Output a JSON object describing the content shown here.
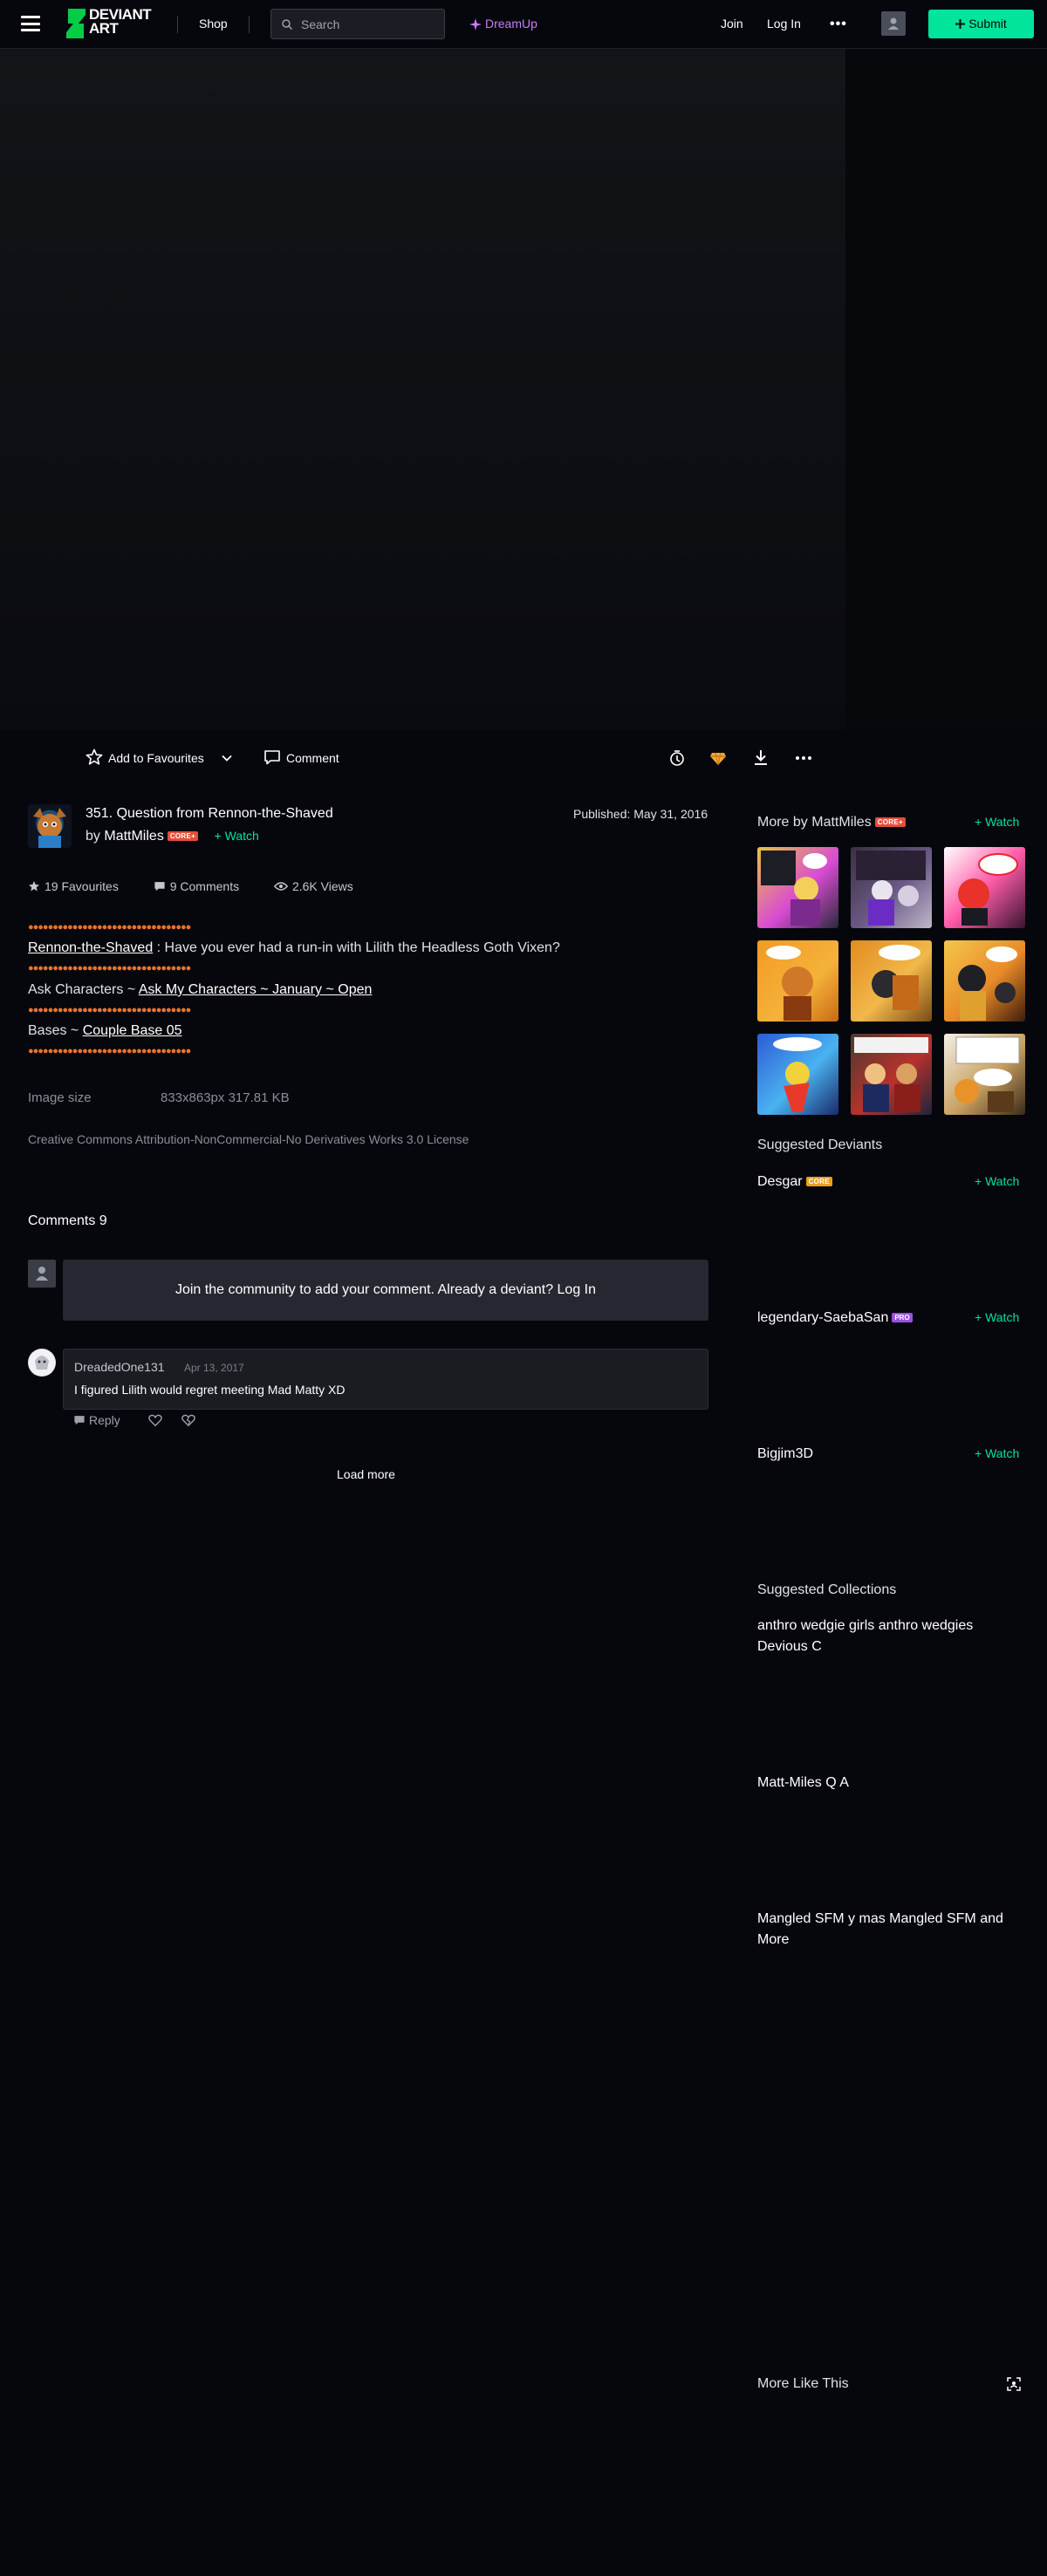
{
  "header": {
    "shop_label": "Shop",
    "search_placeholder": "Search",
    "dreamup_label": "DreamUp",
    "join_label": "Join",
    "login_label": "Log In",
    "more_label": "•••",
    "submit_label": "Submit",
    "logo_text": "DEVIANT ART"
  },
  "actions": {
    "favourite_label": "Add to Favourites",
    "comment_label": "Comment"
  },
  "deviation": {
    "title": "351. Question from Rennon-the-Shaved",
    "by_prefix": "by",
    "author": "MattMiles",
    "author_badge": "CORE+",
    "watch_label": "Watch",
    "published": "Published: May 31, 2016",
    "favourites": "19 Favourites",
    "comments": "9 Comments",
    "views": "2.6K Views"
  },
  "description": {
    "line1_link": "Rennon-the-Shaved",
    "line1_text": " : Have you ever had a run-in with Lilith the Headless Goth Vixen?",
    "line2_prefix": "Ask Characters ~ ",
    "line2_link": "Ask My Characters ~ January ~ Open",
    "line3_prefix": "Bases ~ ",
    "line3_link": "Couple Base 05"
  },
  "details": {
    "image_size_label": "Image size",
    "image_size_value": "833x863px 317.81 KB",
    "license": "Creative Commons Attribution-NonCommercial-No Derivatives Works 3.0 License"
  },
  "comments_section": {
    "header": "Comments 9",
    "join_prompt": "Join the community to add your comment. Already a deviant? Log In",
    "comment": {
      "user": "DreadedOne131",
      "date": "Apr 13, 2017",
      "text": "I figured Lilith would regret meeting Mad Matty XD",
      "reply_label": "Reply"
    },
    "load_more": "Load more"
  },
  "sidebar": {
    "more_by_prefix": "More by ",
    "more_by_author": "MattMiles",
    "more_by_badge": "CORE+",
    "watch_label": "Watch",
    "suggested_deviants_label": "Suggested Deviants",
    "deviants": [
      {
        "name": "Desgar",
        "badge": "CORE",
        "badge_type": "core"
      },
      {
        "name": "legendary-SaebaSan",
        "badge": "PRO",
        "badge_type": "pro"
      },
      {
        "name": "Bigjim3D",
        "badge": "",
        "badge_type": ""
      }
    ],
    "suggested_collections_label": "Suggested Collections",
    "collections": [
      "anthro wedgie girls anthro wedgies Devious C",
      "Matt-Miles Q A",
      "Mangled SFM y mas Mangled SFM and More"
    ],
    "more_like_this_label": "More Like This"
  },
  "colors": {
    "background": "#06070d",
    "accent": "#00e59b",
    "dreamup": "#c87cf9",
    "core_badge": "#e24f3a",
    "pro_badge": "#9a51e0"
  },
  "icons": [
    "menu-icon",
    "search-icon",
    "dreamup-icon",
    "user-icon",
    "plus-icon",
    "star-icon",
    "chevron-down-icon",
    "comment-icon",
    "badge-icon",
    "points-icon",
    "download-icon",
    "more-icon",
    "eye-icon",
    "reply-icon",
    "heart-icon",
    "heart-broken-icon",
    "scan-icon"
  ]
}
